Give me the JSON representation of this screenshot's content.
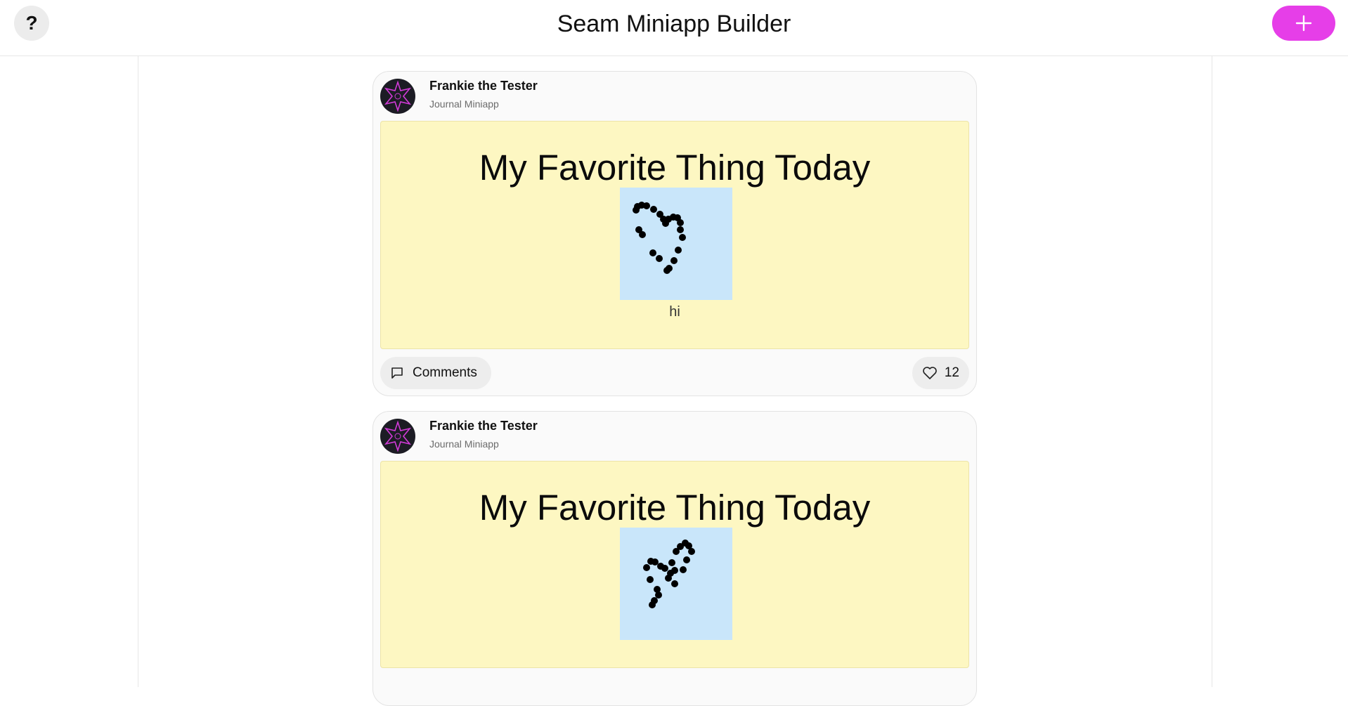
{
  "header": {
    "title": "Seam Miniapp Builder",
    "help_label": "?",
    "add_icon": "plus-icon",
    "accent_color": "#e63ee8"
  },
  "feed": {
    "posts": [
      {
        "author": "Frankie the Tester",
        "app": "Journal Miniapp",
        "heading": "My Favorite Thing Today",
        "caption": "hi",
        "comments_label": "Comments",
        "likes": "12",
        "drawing": "heart-doodle"
      },
      {
        "author": "Frankie the Tester",
        "app": "Journal Miniapp",
        "heading": "My Favorite Thing Today",
        "caption": "",
        "drawing": "heart-doodle-tilted"
      }
    ]
  },
  "colors": {
    "miniapp_background": "#fdf7c2",
    "drawing_background": "#c9e6fa",
    "avatar_star": "#d23ad8"
  }
}
